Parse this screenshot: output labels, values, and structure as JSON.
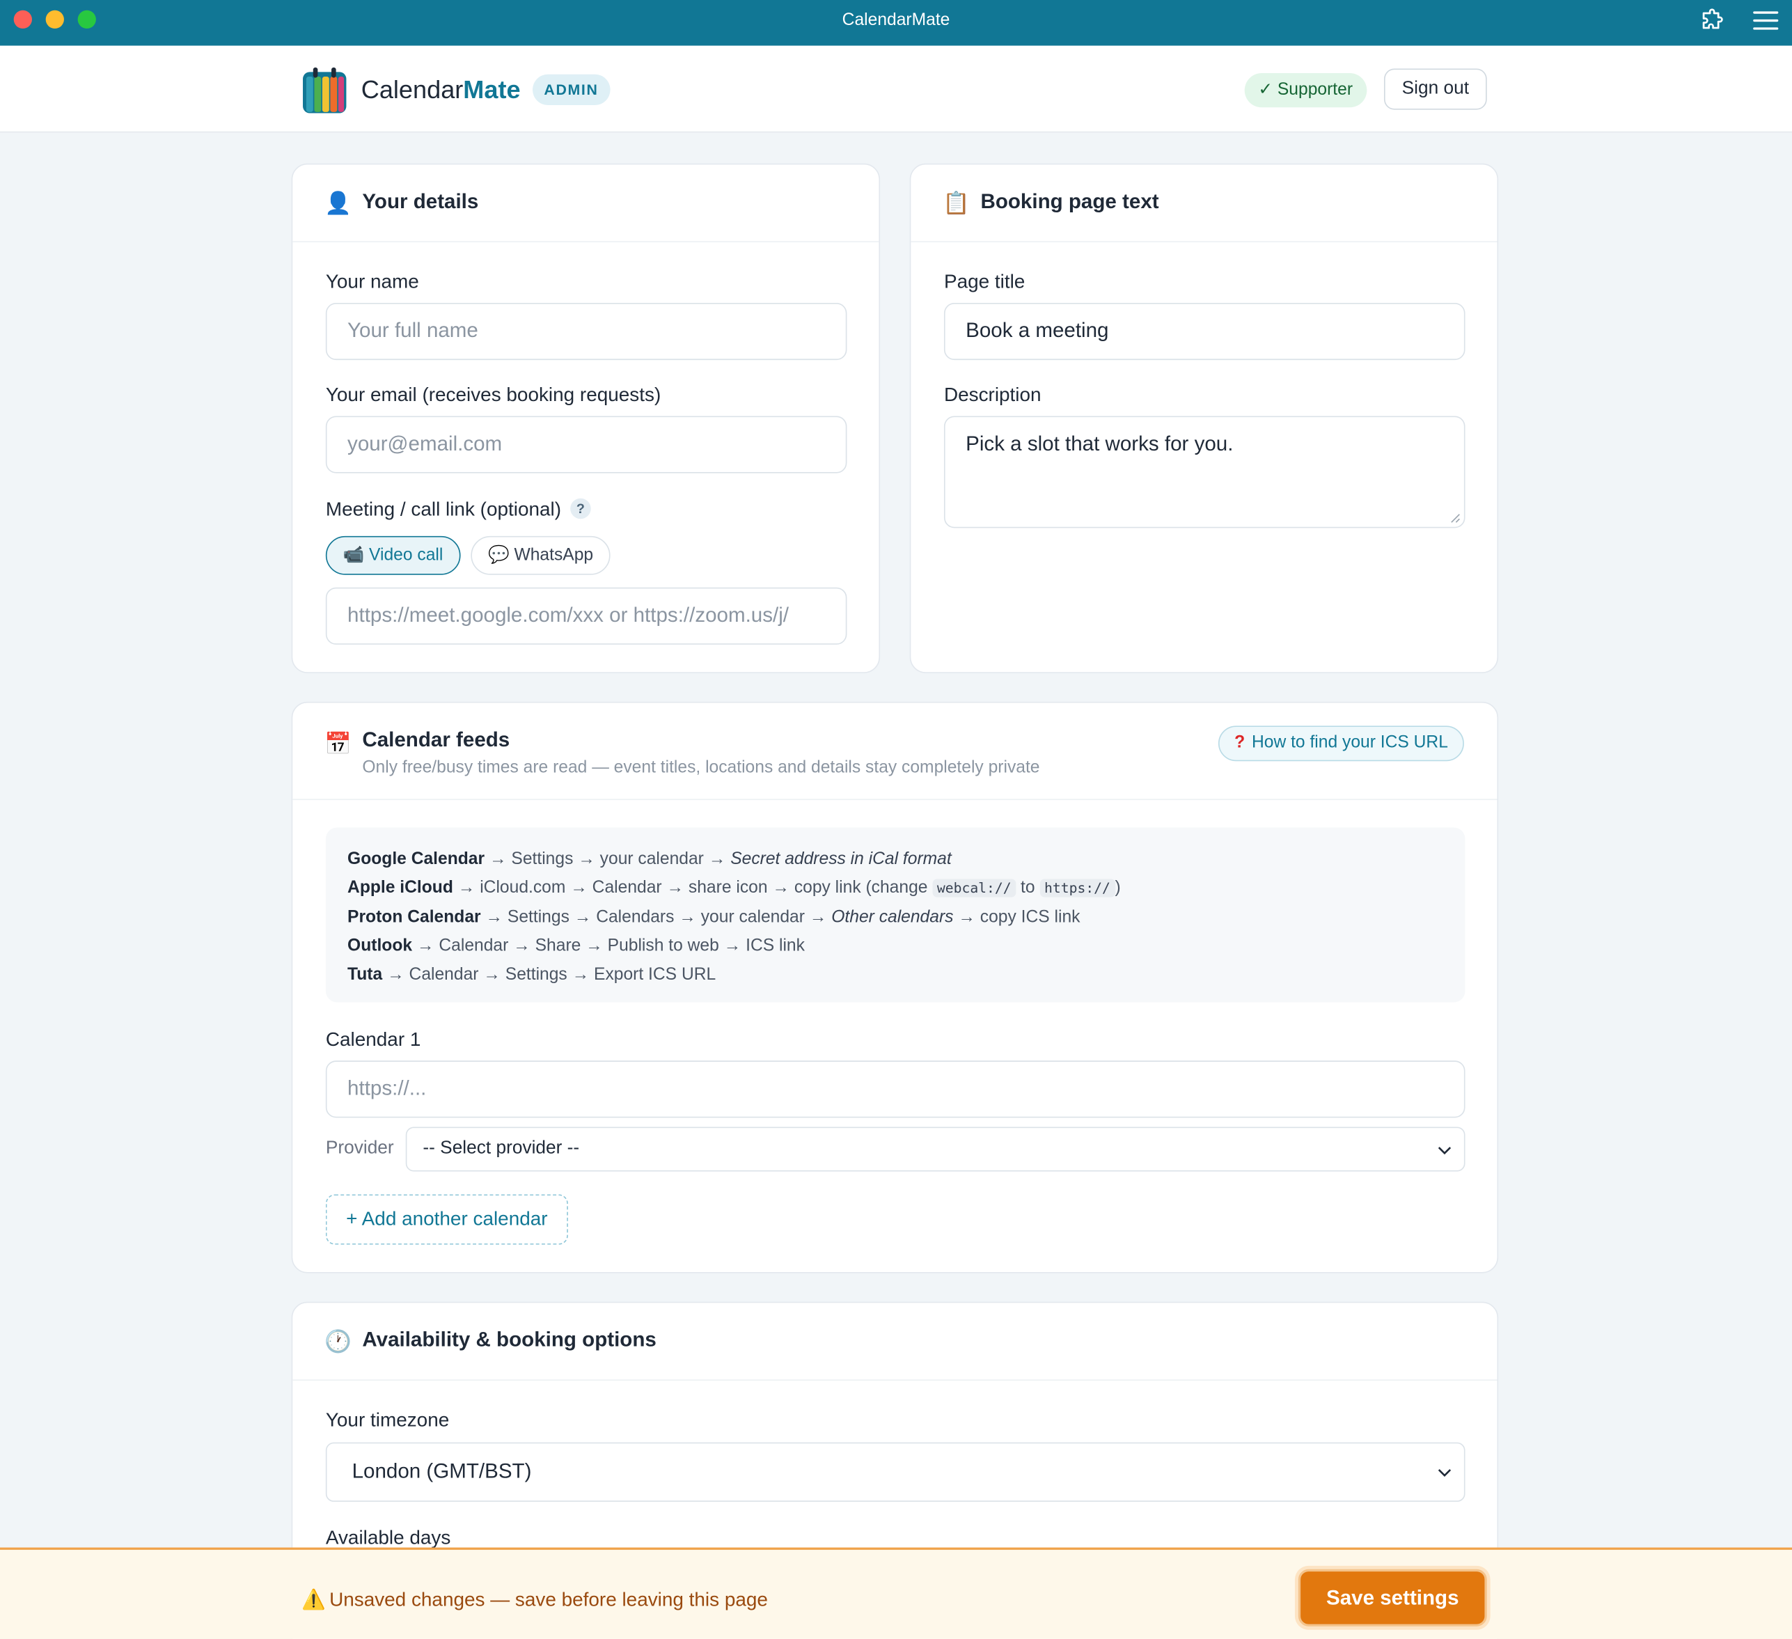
{
  "window": {
    "title": "CalendarMate"
  },
  "header": {
    "brand_prefix": "Calendar",
    "brand_suffix": "Mate",
    "admin_badge": "ADMIN",
    "supporter_badge": "✓ Supporter",
    "sign_out": "Sign out"
  },
  "your_details": {
    "icon": "👤",
    "title": "Your details",
    "name_label": "Your name",
    "name_placeholder": "Your full name",
    "email_label": "Your email (receives booking requests)",
    "email_placeholder": "your@email.com",
    "meeting_label": "Meeting / call link (optional)",
    "help_mark": "?",
    "tabs": [
      {
        "icon": "📹",
        "label": "Video call",
        "active": true
      },
      {
        "icon": "💬",
        "label": "WhatsApp",
        "active": false
      }
    ],
    "link_placeholder": "https://meet.google.com/xxx  or  https://zoom.us/j/"
  },
  "booking_text": {
    "icon": "📋",
    "title": "Booking page text",
    "page_title_label": "Page title",
    "page_title_value": "Book a meeting",
    "description_label": "Description",
    "description_value": "Pick a slot that works for you."
  },
  "calendar_feeds": {
    "icon": "📅",
    "title": "Calendar feeds",
    "subtitle": "Only free/busy times are read — event titles, locations and details stay completely private",
    "help_mark": "?",
    "help_button": "How to find your ICS URL",
    "instructions": {
      "google": {
        "name": "Google Calendar",
        "steps": "→ Settings → your calendar →",
        "italic": "Secret address in iCal format"
      },
      "apple": {
        "name": "Apple iCloud",
        "steps": "→ iCloud.com → Calendar → share icon → copy link (change",
        "code1": "webcal://",
        "middle": "to",
        "code2": "https://",
        "end": ")"
      },
      "proton": {
        "name": "Proton Calendar",
        "steps": "→ Settings → Calendars → your calendar →",
        "italic": "Other calendars",
        "end": "→ copy ICS link"
      },
      "outlook": {
        "name": "Outlook",
        "steps": "→ Calendar → Share → Publish to web → ICS link"
      },
      "tuta": {
        "name": "Tuta",
        "steps": "→ Calendar → Settings → Export ICS URL"
      }
    },
    "calendar1_label": "Calendar 1",
    "calendar1_placeholder": "https://...",
    "provider_label": "Provider",
    "provider_value": "-- Select provider --",
    "add_calendar": "+ Add another calendar"
  },
  "availability": {
    "icon": "🕐",
    "title": "Availability & booking options",
    "timezone_label": "Your timezone",
    "timezone_value": "London (GMT/BST)",
    "available_days_label": "Available days"
  },
  "save_bar": {
    "warning_icon": "⚠️",
    "message": "Unsaved changes — save before leaving this page",
    "save_button": "Save settings"
  },
  "colors": {
    "accent": "#117795",
    "save": "#e2780e",
    "background": "#f1f5f8"
  },
  "icons": [
    "extension-icon",
    "hamburger-menu-icon",
    "calendarmate-logo",
    "person-icon",
    "clipboard-icon",
    "calendar-icon",
    "clock-icon",
    "video-camera-icon",
    "speech-bubble-icon",
    "warning-icon",
    "chevron-down-icon"
  ]
}
